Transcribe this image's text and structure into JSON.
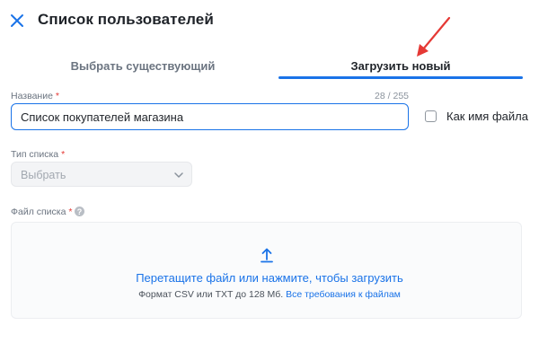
{
  "header": {
    "title": "Список пользователей",
    "close_icon": "close-icon"
  },
  "tabs": [
    {
      "label": "Выбрать существующий",
      "active": false
    },
    {
      "label": "Загрузить новый",
      "active": true
    }
  ],
  "form": {
    "name": {
      "label": "Название",
      "required_mark": "*",
      "value": "Список покупателей магазина",
      "counter": "28 / 255"
    },
    "as_filename": {
      "label": "Как имя файла",
      "checked": false
    },
    "list_type": {
      "label": "Тип списка",
      "required_mark": "*",
      "value": "Выбрать"
    },
    "file": {
      "label": "Файл списка",
      "required_mark": "*",
      "help_icon": "?",
      "drop_text": "Перетащите файл или нажмите, чтобы загрузить",
      "format_text": "Формат CSV или TXT до 128 Мб.",
      "requirements_link": "Все требования к файлам"
    }
  },
  "colors": {
    "accent": "#1a73e8",
    "required": "#e53935",
    "annotation_arrow": "#e53935"
  }
}
